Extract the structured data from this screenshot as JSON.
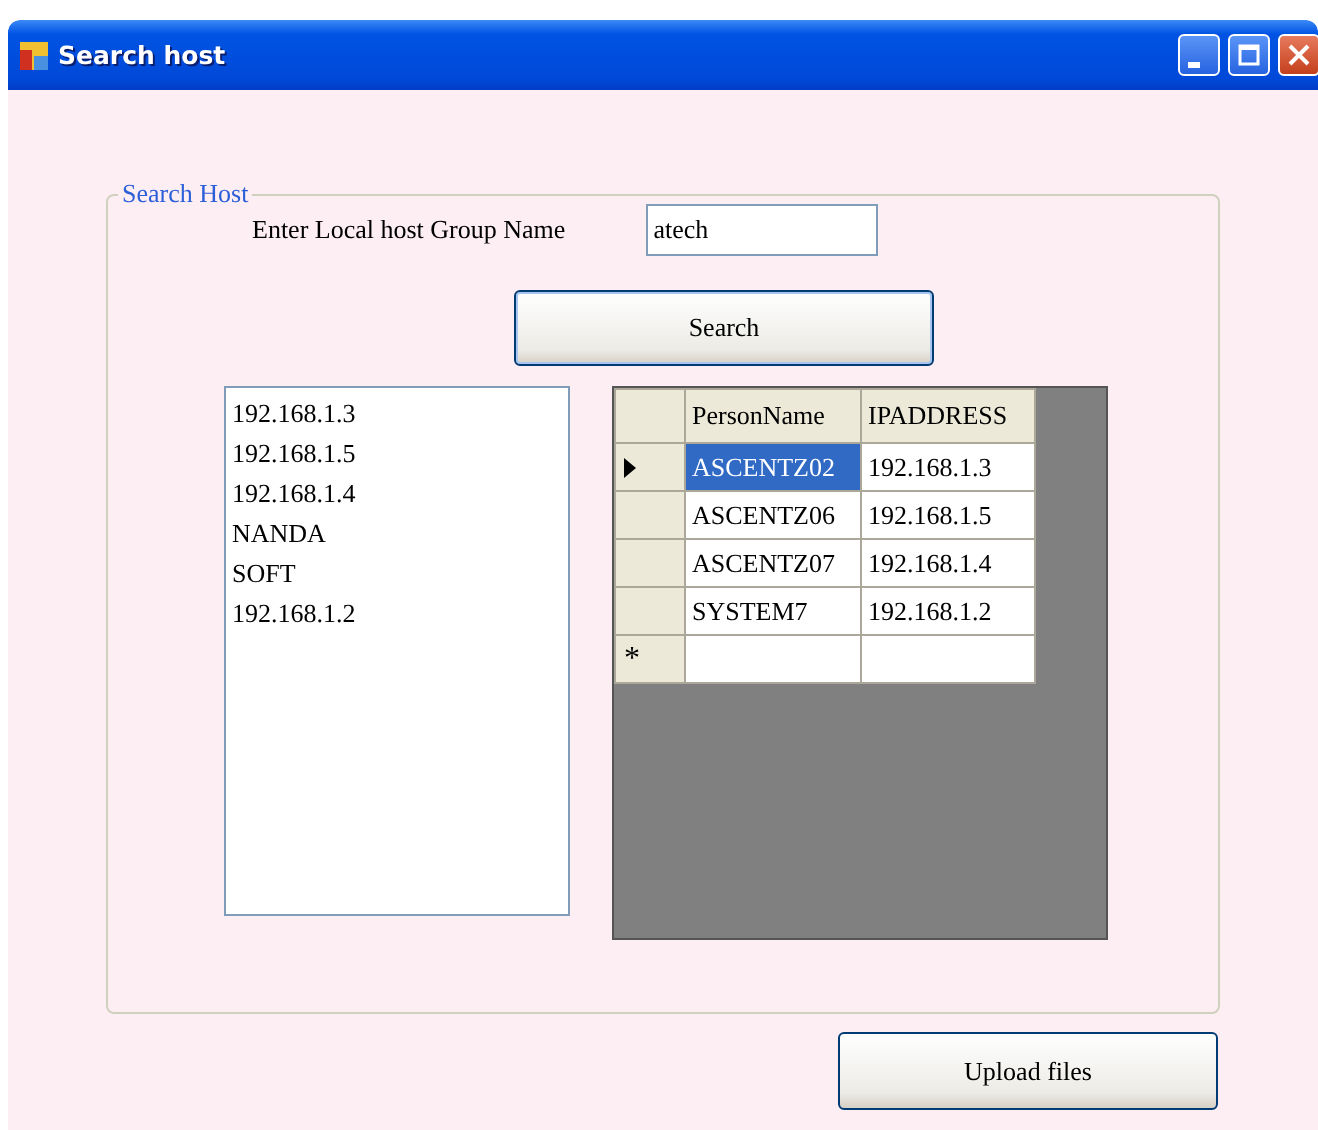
{
  "window": {
    "title": "Search host"
  },
  "group": {
    "title": "Search Host",
    "label": "Enter Local host Group Name",
    "field_value": "atech",
    "search_button": "Search"
  },
  "host_list": {
    "items": [
      "192.168.1.3",
      "192.168.1.5",
      "192.168.1.4",
      "NANDA",
      "SOFT",
      "192.168.1.2"
    ]
  },
  "grid": {
    "columns": [
      "PersonName",
      "IPADDRESS"
    ],
    "rows": [
      {
        "cells": [
          "ASCENTZ02",
          "192.168.1.3"
        ],
        "selected": true
      },
      {
        "cells": [
          "ASCENTZ06",
          "192.168.1.5"
        ],
        "selected": false
      },
      {
        "cells": [
          "ASCENTZ07",
          "192.168.1.4"
        ],
        "selected": false
      },
      {
        "cells": [
          "SYSTEM7",
          "192.168.1.2"
        ],
        "selected": false
      }
    ],
    "new_row_marker": "*"
  },
  "upload_button": "Upload files"
}
